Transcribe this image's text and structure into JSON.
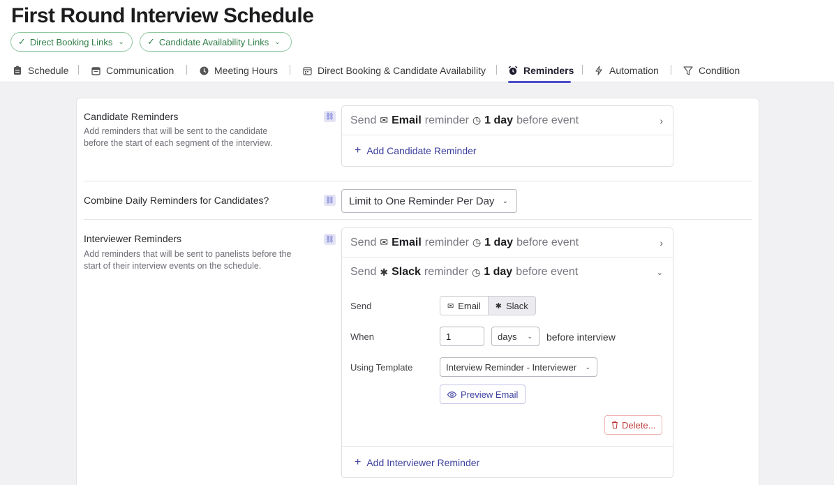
{
  "page": {
    "title": "First Round Interview Schedule"
  },
  "pills": [
    {
      "label": "Direct Booking Links"
    },
    {
      "label": "Candidate Availability Links"
    }
  ],
  "tabs": [
    {
      "label": "Schedule",
      "icon": "clipboard-icon"
    },
    {
      "label": "Communication",
      "icon": "calendar-icon"
    },
    {
      "label": "Meeting Hours",
      "icon": "clock-icon"
    },
    {
      "label": "Direct Booking & Candidate Availability",
      "icon": "calendar-icon"
    },
    {
      "label": "Reminders",
      "icon": "alarm-icon",
      "active": true
    },
    {
      "label": "Automation",
      "icon": "bolt-icon"
    },
    {
      "label": "Condition",
      "icon": "filter-icon"
    }
  ],
  "candidate": {
    "title": "Candidate Reminders",
    "desc": "Add reminders that will be sent to the candidate before the start of each segment of the interview.",
    "reminder": {
      "send": "Send",
      "channel": "Email",
      "reminder": "reminder",
      "amount": "1 day",
      "suffix": "before event"
    },
    "add_label": "Add Candidate Reminder"
  },
  "combine": {
    "title": "Combine Daily Reminders for Candidates?",
    "value": "Limit to One Reminder Per Day"
  },
  "interviewer": {
    "title": "Interviewer Reminders",
    "desc": "Add reminders that will be sent to panelists before the start of their interview events on the schedule.",
    "reminders": [
      {
        "send": "Send",
        "channel": "Email",
        "reminder": "reminder",
        "amount": "1 day",
        "suffix": "before event"
      },
      {
        "send": "Send",
        "channel": "Slack",
        "reminder": "reminder",
        "amount": "1 day",
        "suffix": "before event"
      }
    ],
    "form": {
      "send_label": "Send",
      "channel_email": "Email",
      "channel_slack": "Slack",
      "when_label": "When",
      "when_value": "1",
      "unit_value": "days",
      "when_suffix": "before interview",
      "template_label": "Using Template",
      "template_value": "Interview Reminder - Interviewer",
      "preview_label": "Preview Email",
      "delete_label": "Delete..."
    },
    "add_label": "Add Interviewer Reminder"
  },
  "colors": {
    "accent": "#4b4ec6",
    "pill_green": "#2f7d46",
    "danger": "#c23b3b"
  }
}
